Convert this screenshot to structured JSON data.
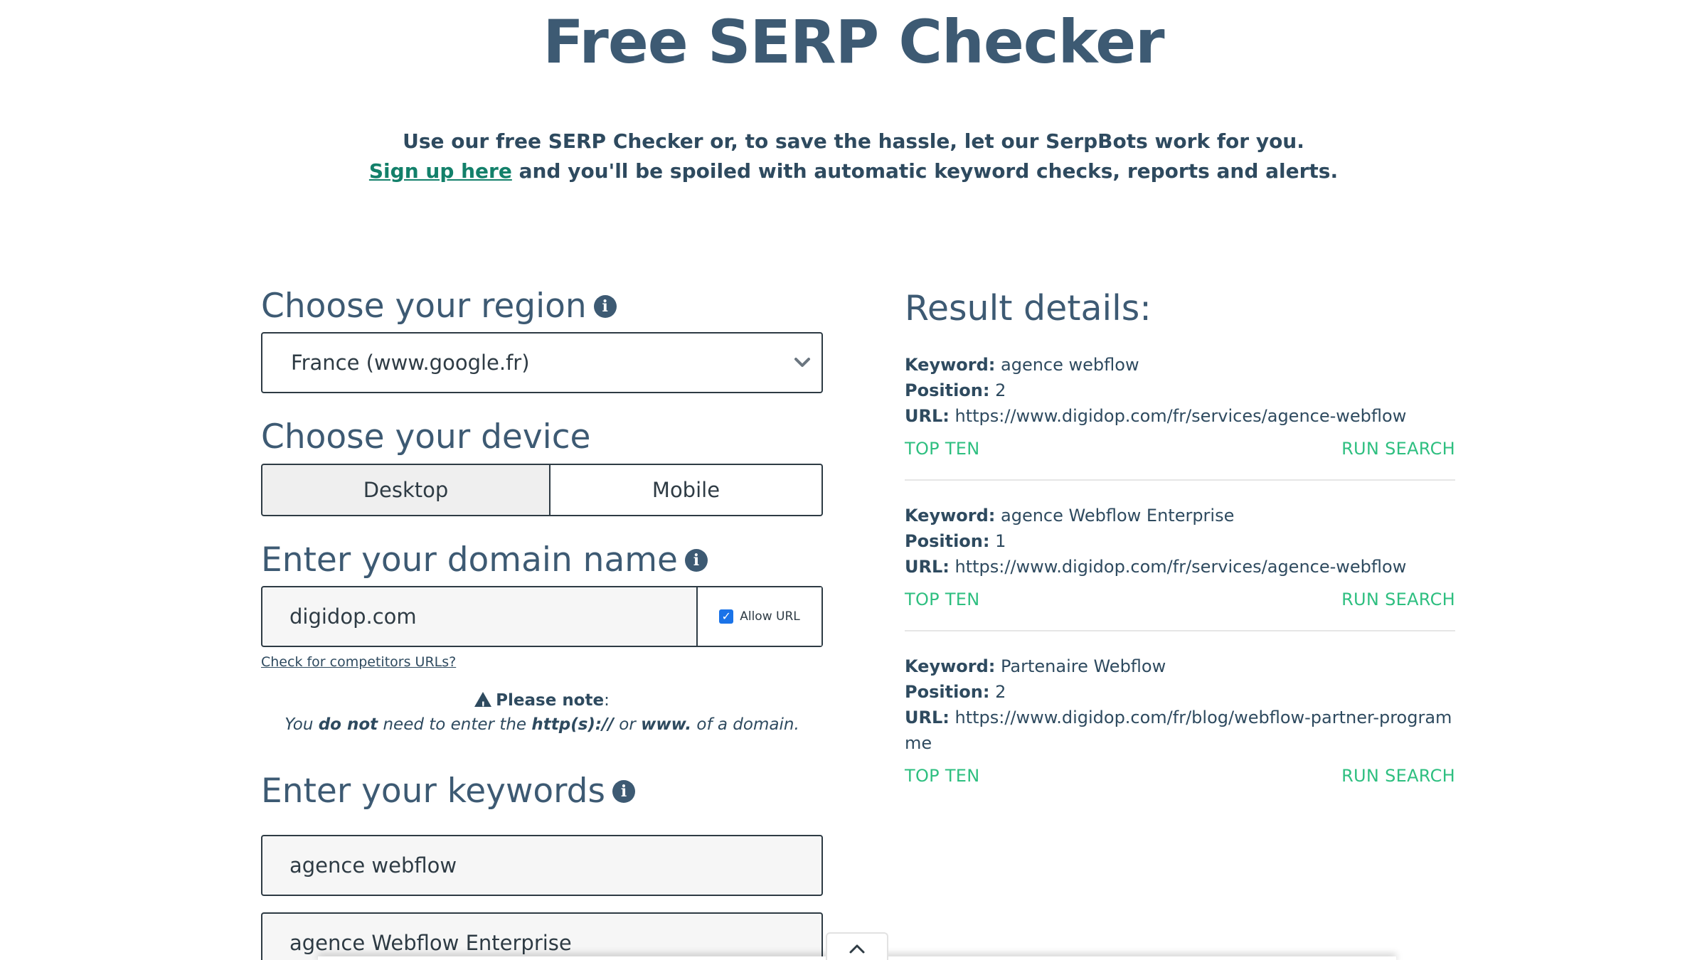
{
  "page": {
    "title": "Free SERP Checker",
    "intro_line1": "Use our free SERP Checker or, to save the hassle, let our SerpBots work for you.",
    "intro_link": "Sign up here",
    "intro_line2": " and you'll be spoiled with automatic keyword checks, reports and alerts."
  },
  "region": {
    "heading": "Choose your region",
    "selected": "France (www.google.fr)"
  },
  "device": {
    "heading": "Choose your device",
    "desktop_label": "Desktop",
    "mobile_label": "Mobile",
    "selected": "Desktop"
  },
  "domain": {
    "heading": "Enter your domain name",
    "value": "digidop.com",
    "allow_url_label": "Allow URL",
    "allow_url_checked": true,
    "competitors_link": "Check for competitors URLs?"
  },
  "note": {
    "title": "Please note",
    "colon": ":",
    "text_1": "You ",
    "bold_1": "do not",
    "text_2": " need to enter the ",
    "bold_2": "http(s)://",
    "text_3": " or ",
    "bold_3": "www.",
    "text_4": " of a domain."
  },
  "keywords": {
    "heading": "Enter your keywords",
    "items": [
      "agence webflow",
      "agence Webflow Enterprise"
    ]
  },
  "results": {
    "heading": "Result details:",
    "keyword_label": "Keyword:",
    "position_label": "Position:",
    "url_label": "URL:",
    "top_ten_label": "TOP TEN",
    "run_search_label": "RUN SEARCH",
    "items": [
      {
        "keyword": "agence webflow",
        "position": "2",
        "url": "https://www.digidop.com/fr/services/agence-webflow"
      },
      {
        "keyword": "agence Webflow Enterprise",
        "position": "1",
        "url": "https://www.digidop.com/fr/services/agence-webflow"
      },
      {
        "keyword": "Partenaire Webflow",
        "position": "2",
        "url_line1": "https://www.digidop.com/fr/blog/webflow-partner-program",
        "url_line2": "me"
      }
    ]
  },
  "colors": {
    "heading": "#3d5a73",
    "link": "#13806a",
    "action": "#2ebf80",
    "checkbox": "#1a73e8"
  },
  "icons": {
    "info": "info-icon",
    "chevron": "chevron-down-icon",
    "warning": "warning-icon",
    "scroll_top": "chevron-up-icon"
  }
}
